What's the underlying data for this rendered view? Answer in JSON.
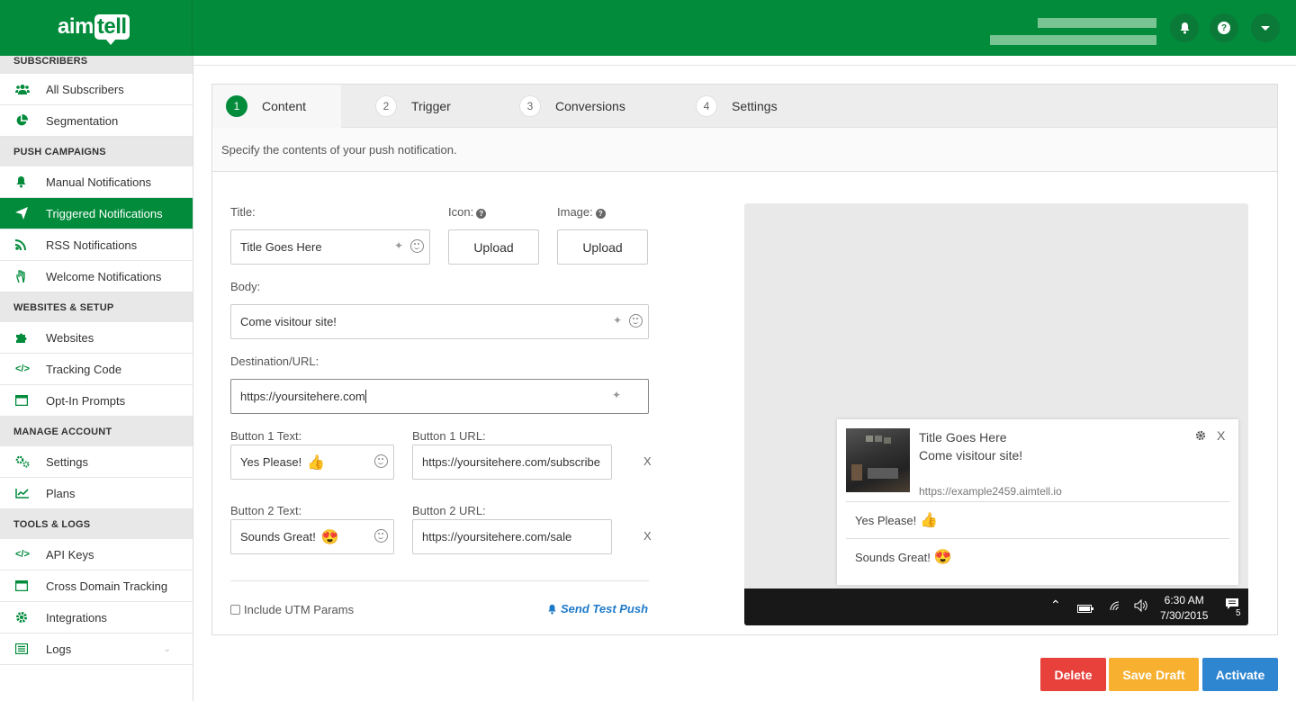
{
  "app": {
    "logo_text_a": "aim",
    "logo_text_b": "tell",
    "brand_color": "#018b3b"
  },
  "header": {
    "notifications_icon": "bell-icon",
    "help_icon": "question-icon",
    "menu_icon": "caret-down-icon"
  },
  "sidebar": {
    "sections": [
      {
        "label": "SUBSCRIBERS"
      },
      {
        "label": "PUSH CAMPAIGNS"
      },
      {
        "label": "WEBSITES & SETUP"
      },
      {
        "label": "MANAGE ACCOUNT"
      },
      {
        "label": "TOOLS & LOGS"
      }
    ],
    "items": [
      {
        "label": "All Subscribers",
        "icon": "users-icon"
      },
      {
        "label": "Segmentation",
        "icon": "pie-chart-icon"
      },
      {
        "label": "Manual Notifications",
        "icon": "bell-icon"
      },
      {
        "label": "Triggered Notifications",
        "icon": "paper-plane-icon",
        "active": true
      },
      {
        "label": "RSS Notifications",
        "icon": "rss-icon"
      },
      {
        "label": "Welcome Notifications",
        "icon": "hand-wave-icon"
      },
      {
        "label": "Websites",
        "icon": "puzzle-icon"
      },
      {
        "label": "Tracking Code",
        "icon": "code-icon"
      },
      {
        "label": "Opt-In Prompts",
        "icon": "window-icon"
      },
      {
        "label": "Settings",
        "icon": "gears-icon"
      },
      {
        "label": "Plans",
        "icon": "line-chart-icon"
      },
      {
        "label": "API Keys",
        "icon": "code-icon"
      },
      {
        "label": "Cross Domain Tracking",
        "icon": "window-icon"
      },
      {
        "label": "Integrations",
        "icon": "gear-icon"
      },
      {
        "label": "Logs",
        "icon": "list-icon"
      }
    ]
  },
  "tabs": [
    {
      "num": "1",
      "label": "Content",
      "active": true
    },
    {
      "num": "2",
      "label": "Trigger"
    },
    {
      "num": "3",
      "label": "Conversions"
    },
    {
      "num": "4",
      "label": "Settings"
    }
  ],
  "form": {
    "description": "Specify the contents of your push notification.",
    "title_label": "Title:",
    "title_value": "Title Goes Here",
    "icon_label": "Icon:",
    "image_label": "Image:",
    "upload_label": "Upload",
    "body_label": "Body:",
    "body_value": "Come visitour site!",
    "url_label": "Destination/URL:",
    "url_value": "https://yoursitehere.com",
    "button1_text_label": "Button 1 Text:",
    "button1_text_value": "Yes Please!",
    "button1_url_label": "Button 1 URL:",
    "button1_url_value": "https://yoursitehere.com/subscribe",
    "button2_text_label": "Button 2 Text:",
    "button2_text_value": "Sounds Great!",
    "button2_url_label": "Button 2 URL:",
    "button2_url_value": "https://yoursitehere.com/sale",
    "remove_label": "X",
    "utm_label": "Include UTM Params",
    "utm_checked": false,
    "send_test_label": "Send Test Push"
  },
  "preview": {
    "title": "Title Goes Here",
    "body": "Come visitour site!",
    "url": "https://example2459.aimtell.io",
    "close": "X",
    "button1": "Yes Please!",
    "button2": "Sounds Great!",
    "time": "6:30 AM",
    "date": "7/30/2015",
    "notif_count": "5"
  },
  "actions": {
    "delete": "Delete",
    "save_draft": "Save Draft",
    "activate": "Activate",
    "delete_color": "#e8403b",
    "save_color": "#f7b030",
    "activate_color": "#2f86d0"
  }
}
